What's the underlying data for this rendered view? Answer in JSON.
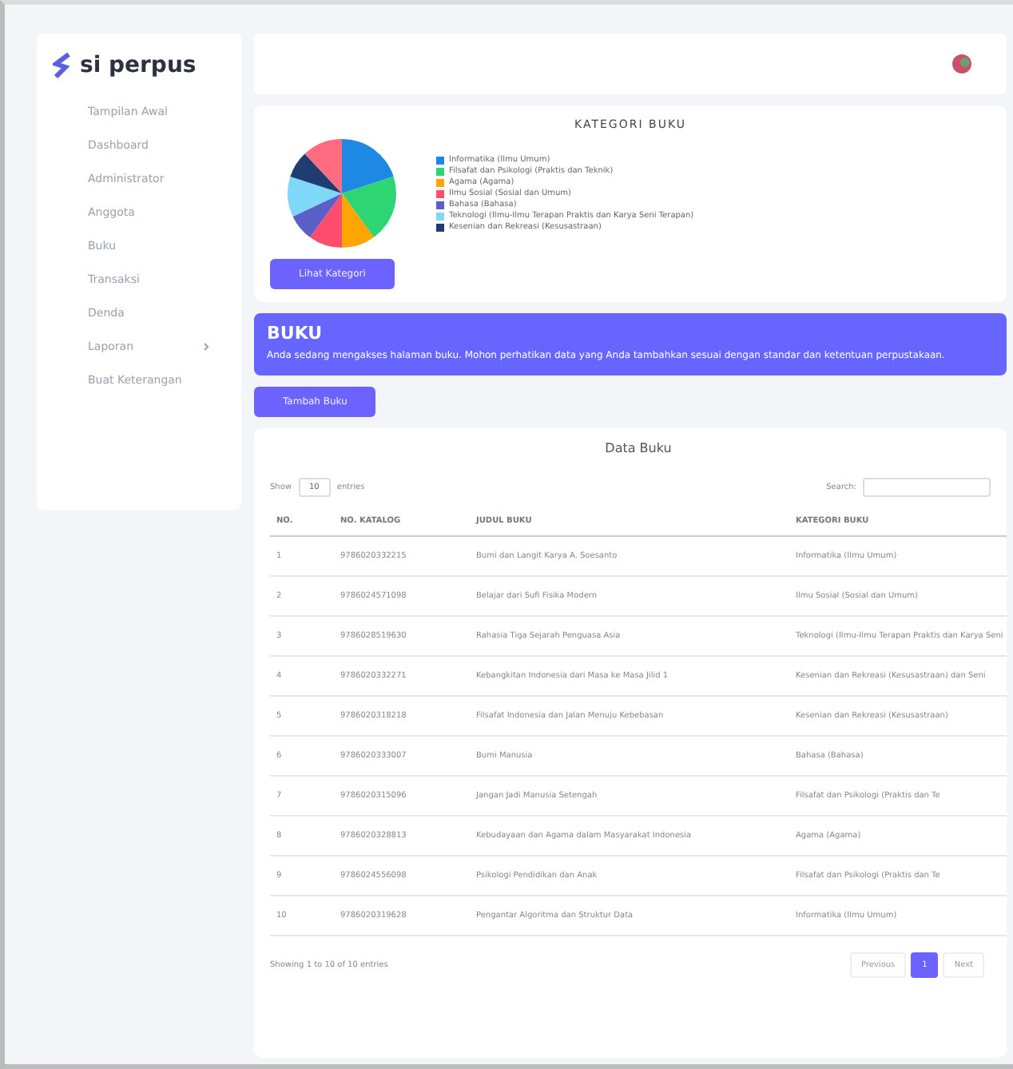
{
  "sidebar": {
    "logo": "si perpus",
    "items": [
      {
        "label": "Tampilan Awal",
        "selected": false,
        "expandable": false
      },
      {
        "label": "Dashboard",
        "selected": false,
        "expandable": false
      },
      {
        "label": "Administrator",
        "selected": false,
        "expandable": false
      },
      {
        "label": "Anggota",
        "selected": false,
        "expandable": false
      },
      {
        "label": "Buku",
        "selected": false,
        "expandable": false
      },
      {
        "label": "Transaksi",
        "selected": false,
        "expandable": false
      },
      {
        "label": "Denda",
        "selected": false,
        "expandable": false
      },
      {
        "label": "Laporan",
        "selected": false,
        "expandable": true
      },
      {
        "label": "Buat Keterangan",
        "selected": false,
        "expandable": false
      }
    ]
  },
  "category_card": {
    "title": "KATEGORI BUKU",
    "legend": [
      {
        "label": "Informatika (Ilmu Umum)",
        "color": "#1e88e5"
      },
      {
        "label": "Filsafat dan Psikologi (Praktis dan Teknik)",
        "color": "#2ed573"
      },
      {
        "label": "Agama (Agama)",
        "color": "#ffa502"
      },
      {
        "label": "Ilmu Sosial (Sosial dan Umum)",
        "color": "#ff4d6d"
      },
      {
        "label": "Bahasa (Bahasa)",
        "color": "#5b5fc7"
      },
      {
        "label": "Teknologi (Ilmu-Ilmu Terapan Praktis dan Karya Seni Terapan)",
        "color": "#7fd8f7"
      },
      {
        "label": "Kesenian dan Rekreasi (Kesusastraan)",
        "color": "#1f3c73"
      }
    ],
    "button": "Lihat Kategori"
  },
  "banner": {
    "title": "BUKU",
    "text": "Anda sedang mengakses halaman buku. Mohon perhatikan data yang Anda tambahkan sesuai dengan standar dan ketentuan perpustakaan."
  },
  "add_button": "Tambah Buku",
  "table": {
    "title": "Data Buku",
    "show_label": "Show",
    "show_value": "10",
    "entries_label": "entries",
    "search_label": "Search:",
    "columns": [
      "NO.",
      "NO. KATALOG",
      "JUDUL BUKU",
      "KATEGORI BUKU"
    ],
    "rows": [
      [
        "1",
        "9786020332215",
        "Bumi dan Langit Karya A. Soesanto",
        "Informatika (Ilmu Umum)"
      ],
      [
        "2",
        "9786024571098",
        "Belajar dari Sufi Fisika Modern",
        "Ilmu Sosial (Sosial dan Umum)"
      ],
      [
        "3",
        "9786028519630",
        "Rahasia Tiga Sejarah Penguasa Asia",
        "Teknologi (Ilmu-Ilmu Terapan Praktis dan Karya Seni"
      ],
      [
        "4",
        "9786020332271",
        "Kebangkitan Indonesia dari Masa ke Masa Jilid 1",
        "Kesenian dan Rekreasi (Kesusastraan) dan Seni"
      ],
      [
        "5",
        "9786020318218",
        "Filsafat Indonesia dan Jalan Menuju Kebebasan",
        "Kesenian dan Rekreasi (Kesusastraan)"
      ],
      [
        "6",
        "9786020333007",
        "Bumi Manusia",
        "Bahasa (Bahasa)"
      ],
      [
        "7",
        "9786020315096",
        "Jangan Jadi Manusia Setengah",
        "Filsafat dan Psikologi (Praktis dan Te"
      ],
      [
        "8",
        "9786020328813",
        "Kebudayaan dan Agama dalam Masyarakat Indonesia",
        "Agama (Agama)"
      ],
      [
        "9",
        "9786024556098",
        "Psikologi Pendidikan dan Anak",
        "Filsafat dan Psikologi (Praktis dan Te"
      ],
      [
        "10",
        "9786020319628",
        "Pengantar Algoritma dan Struktur Data",
        "Informatika (Ilmu Umum)"
      ]
    ]
  },
  "footer": {
    "info": "Showing 1 to 10 of 10 entries",
    "pages": [
      {
        "label": "Previous",
        "selected": false
      },
      {
        "label": "1",
        "selected": true
      },
      {
        "label": "Next",
        "selected": false
      }
    ]
  }
}
